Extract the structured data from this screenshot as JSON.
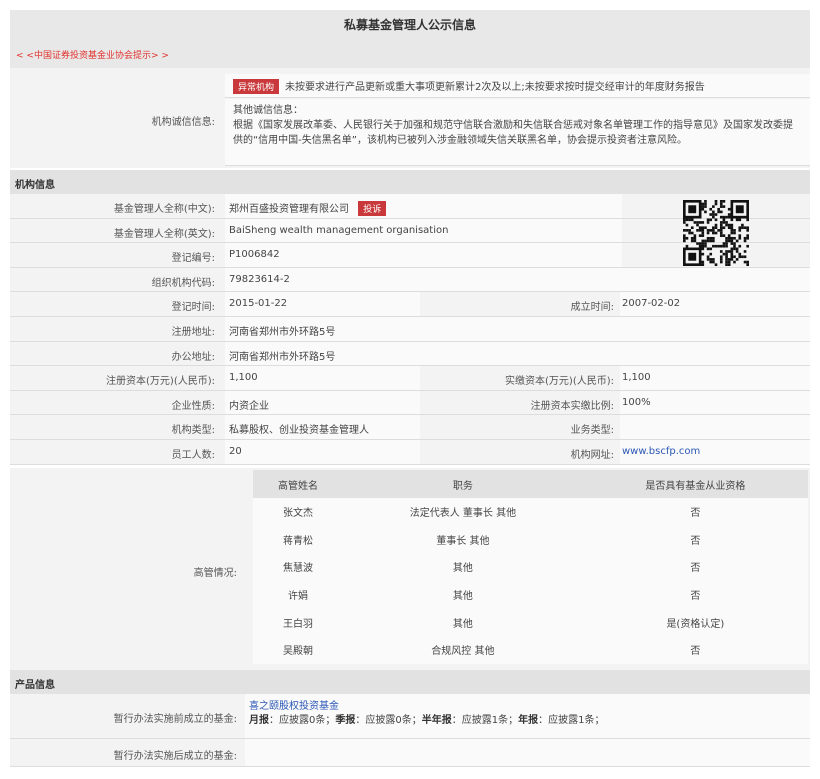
{
  "title": "私募基金管理人公示信息",
  "notice_link": "< <中国证券投资基金业协会提示> >",
  "credit": {
    "label": "机构诚信信息:",
    "badge": "异常机构",
    "abnormal_text": "未按要求进行产品更新或重大事项更新累计2次及以上;未按要求按时提交经审计的年度财务报告",
    "other_title": "其他诚信信息：",
    "other_text": "根据《国家发展改革委、人民银行关于加强和规范守信联合激励和失信联合惩戒对象名单管理工作的指导意见》及国家发改委提供的“信用中国-失信黑名单”，该机构已被列入涉金融领域失信关联黑名单，协会提示投资者注意风险。"
  },
  "org": {
    "section": "机构信息",
    "complaint": "投诉",
    "rows": [
      {
        "label": "基金管理人全称(中文):",
        "value": "郑州百盛投资管理有限公司"
      },
      {
        "label": "基金管理人全称(英文):",
        "value": "BaiSheng wealth management organisation"
      },
      {
        "label": "登记编号:",
        "value": "P1006842"
      },
      {
        "label": "组织机构代码:",
        "value": "79823614-2"
      },
      {
        "label": "登记时间:",
        "value": "2015-01-22",
        "label2": "成立时间:",
        "value2": "2007-02-02"
      },
      {
        "label": "注册地址:",
        "value": "河南省郑州市外环路5号"
      },
      {
        "label": "办公地址:",
        "value": "河南省郑州市外环路5号"
      },
      {
        "label": "注册资本(万元)(人民币):",
        "value": "1,100",
        "label2": "实缴资本(万元)(人民币):",
        "value2": "1,100"
      },
      {
        "label": "企业性质:",
        "value": "内资企业",
        "label2": "注册资本实缴比例:",
        "value2": "100%"
      },
      {
        "label": "机构类型:",
        "value": "私募股权、创业投资基金管理人",
        "label2": "业务类型:",
        "value2": ""
      },
      {
        "label": "员工人数:",
        "value": "20",
        "label2": "机构网址:",
        "value2": "www.bscfp.com"
      }
    ]
  },
  "management": {
    "label": "高管情况:",
    "headers": [
      "高管姓名",
      "职务",
      "是否具有基金从业资格"
    ],
    "rows": [
      [
        "张文杰",
        "法定代表人 董事长 其他",
        "否"
      ],
      [
        "蒋青松",
        "董事长 其他",
        "否"
      ],
      [
        "焦慧波",
        "其他",
        "否"
      ],
      [
        "许娟",
        "其他",
        "否"
      ],
      [
        "王白羽",
        "其他",
        "是(资格认定)"
      ],
      [
        "吴殿朝",
        "合规风控 其他",
        "否"
      ]
    ]
  },
  "products": {
    "section": "产品信息",
    "before_label": "暂行办法实施前成立的基金:",
    "fund_name": "喜之颐股权投资基金",
    "reports": [
      {
        "k": "月报",
        "v": "：应披露0条；"
      },
      {
        "k": "季报",
        "v": "：应披露0条；"
      },
      {
        "k": "半年报",
        "v": "：应披露1条；"
      },
      {
        "k": "年报",
        "v": "：应披露1条；"
      }
    ],
    "after_label": "暂行办法实施后成立的基金:"
  }
}
